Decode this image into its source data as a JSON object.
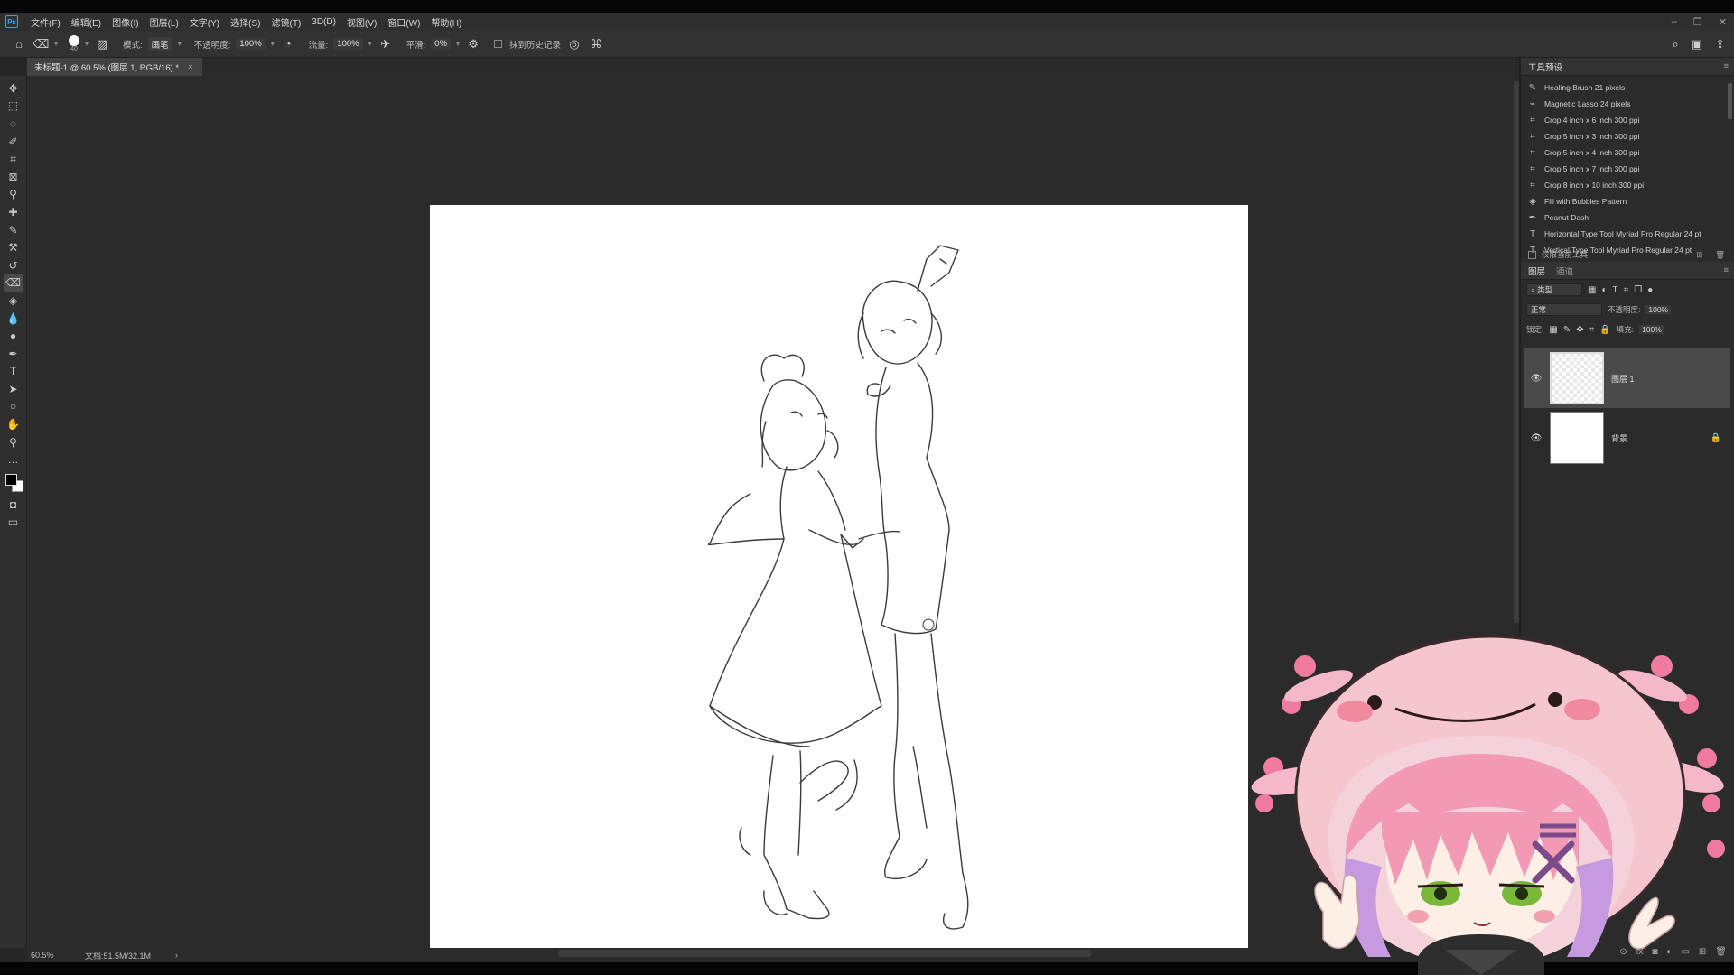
{
  "app": {
    "logo_text": "Ps",
    "menu": [
      "文件(F)",
      "编辑(E)",
      "图像(I)",
      "图层(L)",
      "文字(Y)",
      "选择(S)",
      "滤镜(T)",
      "3D(D)",
      "视图(V)",
      "窗口(W)",
      "帮助(H)"
    ],
    "window_controls": {
      "minimize": "–",
      "restore": "❐",
      "close": "✕"
    }
  },
  "options_bar": {
    "brush_size": "40",
    "mode_label": "模式:",
    "mode_value": "画笔",
    "opacity_label": "不透明度:",
    "opacity_value": "100%",
    "flow_label": "流量:",
    "flow_value": "100%",
    "smoothing_label": "平滑:",
    "smoothing_value": "0%",
    "erase_history_label": "抹到历史记录"
  },
  "document": {
    "tab_title": "未标题-1 @ 60.5% (图层 1, RGB/16) *",
    "tab_close": "×"
  },
  "status": {
    "zoom": "60.5%",
    "doc_size": "文档:51.5M/32.1M",
    "arrow": "›"
  },
  "tool_presets": {
    "title": "工具预设",
    "items": [
      {
        "icon": "healing-brush-icon",
        "glyph": "✎",
        "label": "Healing Brush 21 pixels"
      },
      {
        "icon": "magnetic-lasso-icon",
        "glyph": "⌁",
        "label": "Magnetic Lasso 24 pixels"
      },
      {
        "icon": "crop-icon",
        "glyph": "⌗",
        "label": "Crop 4 inch x 6 inch 300 ppi"
      },
      {
        "icon": "crop-icon",
        "glyph": "⌗",
        "label": "Crop 5 inch x 3 inch 300 ppi"
      },
      {
        "icon": "crop-icon",
        "glyph": "⌗",
        "label": "Crop 5 inch x 4 inch 300 ppi"
      },
      {
        "icon": "crop-icon",
        "glyph": "⌗",
        "label": "Crop 5 inch x 7 inch 300 ppi"
      },
      {
        "icon": "crop-icon",
        "glyph": "⌗",
        "label": "Crop 8 inch x 10 inch 300 ppi"
      },
      {
        "icon": "paint-bucket-icon",
        "glyph": "◈",
        "label": "Fill with Bubbles Pattern"
      },
      {
        "icon": "pen-icon",
        "glyph": "✒",
        "label": "Peanut Dash"
      },
      {
        "icon": "type-icon",
        "glyph": "T",
        "label": "Horizontal Type Tool Myriad Pro Regular 24 pt"
      },
      {
        "icon": "type-icon",
        "glyph": "T",
        "label": "Vertical Type Tool Myriad Pro Regular 24 pt"
      }
    ],
    "current_tool_only": "仅限当前工具"
  },
  "layers_panel": {
    "tab_layers": "图层",
    "tab_channels": "通道",
    "kind_filter": "类型",
    "blend_mode": "正常",
    "opacity_label": "不透明度:",
    "opacity_value": "100%",
    "lock_label": "锁定:",
    "fill_label": "填充:",
    "fill_value": "100%",
    "layers": [
      {
        "name": "图层 1",
        "selected": true
      },
      {
        "name": "背景",
        "selected": false,
        "locked": true
      }
    ],
    "footer_icons": [
      "link-icon",
      "fx-icon",
      "mask-icon",
      "adjustment-icon",
      "group-icon",
      "new-layer-icon",
      "trash-icon"
    ],
    "footer_glyphs": [
      "⊙",
      "fx",
      "◙",
      "◐",
      "▭",
      "⊞",
      "🗑"
    ]
  },
  "colors": {
    "foreground": "#000000",
    "background": "#ffffff",
    "accent": "#2fa3ff"
  }
}
